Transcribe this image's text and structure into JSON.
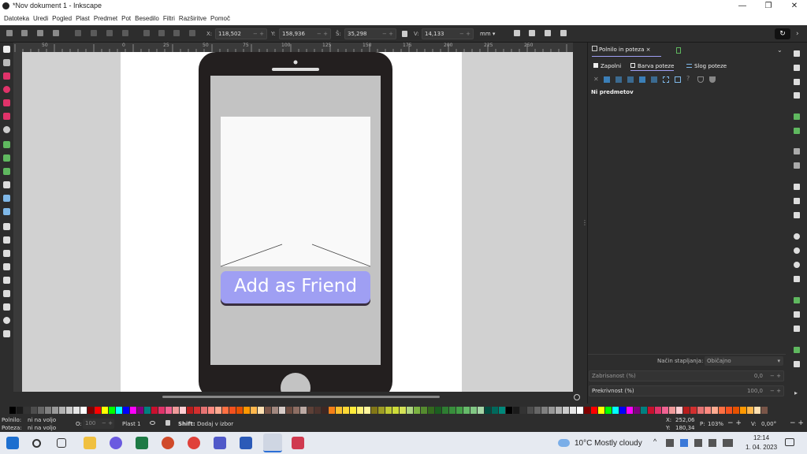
{
  "window": {
    "title": "*Nov dokument 1 - Inkscape",
    "minimize": "—",
    "maximize": "❐",
    "close": "✕"
  },
  "menu": [
    "Datoteka",
    "Uredi",
    "Pogled",
    "Plast",
    "Predmet",
    "Pot",
    "Besedilo",
    "Filtri",
    "Razširitve",
    "Pomoč"
  ],
  "toolbar": {
    "x_label": "X:",
    "x": "118,502",
    "y_label": "Y:",
    "y": "158,936",
    "w_label": "Š:",
    "w": "35,298",
    "h_label": "V:",
    "h": "14,133",
    "unit": "mm"
  },
  "ruler": {
    "ticks": [
      "50",
      "0",
      "25",
      "50",
      "75",
      "100",
      "125",
      "150",
      "175",
      "200",
      "225",
      "250"
    ]
  },
  "mockup": {
    "button_label": "Add as Friend"
  },
  "panel": {
    "tab_title": "Polnilo in poteza",
    "tab_close": "×",
    "subtabs": [
      "Zapolni",
      "Barva poteze",
      "Slog poteze"
    ],
    "no_objects": "Ni predmetov",
    "blend_label": "Način stapljanja:",
    "blend_value": "Običajno",
    "blur_label": "Zabrisanost (%)",
    "blur_value": "0,0",
    "opacity_label": "Prekrivnost (%)",
    "opacity_value": "100,0"
  },
  "status": {
    "fill_label": "Polnilo:",
    "fill_value": "ni na voljo",
    "stroke_label": "Poteza:",
    "stroke_value": "ni na voljo",
    "opacity_short": "O:",
    "opacity_value": "100",
    "layer": "Plast 1",
    "hint_key": "Shift:",
    "hint_text": "Dodaj v izbor",
    "x_label": "X:",
    "x": "252,06",
    "y_label": "Y:",
    "y": "180,34",
    "zoom_label": "P:",
    "zoom": "103%",
    "rot_label": "V:",
    "rot": "0,00°"
  },
  "taskbar": {
    "weather": "10°C  Mostly cloudy",
    "time": "12:14",
    "date": "1. 04. 2023"
  },
  "colors": {
    "accent": "#9f9ff3",
    "phone": "#231f1f",
    "screen": "#c3c3c3",
    "canvas": "#d1d1d1"
  }
}
